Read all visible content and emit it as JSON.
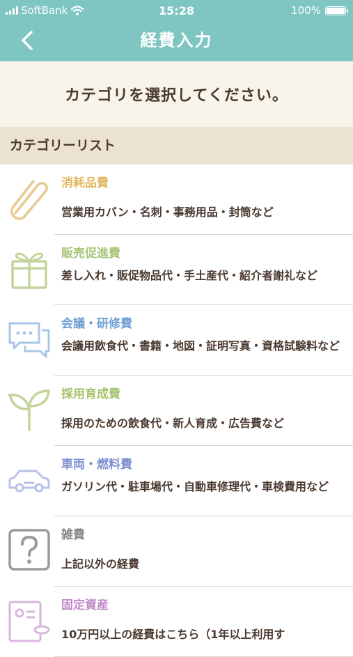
{
  "status_bar": {
    "carrier": "SoftBank",
    "time": "15:28",
    "battery": "100%"
  },
  "nav": {
    "title": "経費入力",
    "back_icon": "chevron-left-icon"
  },
  "prompt": "カテゴリを選択してください。",
  "section": {
    "title": "カテゴリーリスト"
  },
  "colors": {
    "header": "#7fc6c2",
    "consumables": "#e3b860",
    "sales": "#a8c476",
    "meeting": "#6e9fd4",
    "hiring": "#a6c46e",
    "vehicle": "#7d8ed0",
    "misc": "#8a8a8a",
    "fixed": "#c08ac8"
  },
  "categories": [
    {
      "title": "消耗品費",
      "desc": "営業用カバン・名刺・事務用品・封筒など",
      "icon": "paperclip-icon"
    },
    {
      "title": "販売促進費",
      "desc": "差し入れ・販促物品代・手土産代・紹介者謝礼など",
      "icon": "gift-icon"
    },
    {
      "title": "会議・研修費",
      "desc": "会議用飲食代・書籍・地図・証明写真・資格試験料など",
      "icon": "chat-bubbles-icon"
    },
    {
      "title": "採用育成費",
      "desc": "採用のための飲食代・新人育成・広告費など",
      "icon": "sprout-icon"
    },
    {
      "title": "車両・燃料費",
      "desc": "ガソリン代・駐車場代・自動車修理代・車検費用など",
      "icon": "car-icon"
    },
    {
      "title": "雑費",
      "desc": "上記以外の経費",
      "icon": "question-icon"
    },
    {
      "title": "固定資産",
      "desc": "10万円以上の経費はこちら（1年以上利用す",
      "icon": "asset-icon"
    }
  ]
}
